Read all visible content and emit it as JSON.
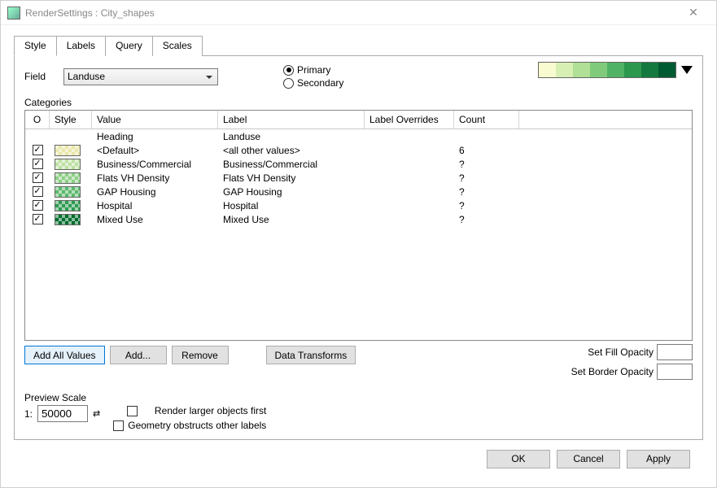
{
  "window": {
    "title": "RenderSettings : City_shapes"
  },
  "tabs": [
    "Style",
    "Labels",
    "Query",
    "Scales"
  ],
  "field": {
    "label": "Field",
    "value": "Landuse"
  },
  "mode": {
    "primary": {
      "label": "Primary",
      "selected": true
    },
    "secondary": {
      "label": "Secondary",
      "selected": false
    }
  },
  "ramp_colors": [
    "#f8fbd0",
    "#d8efb3",
    "#afe095",
    "#7fcb7b",
    "#50b264",
    "#2b984e",
    "#14793f",
    "#005a32"
  ],
  "categories_label": "Categories",
  "grid": {
    "headers": {
      "o": "O",
      "style": "Style",
      "value": "Value",
      "label": "Label",
      "over": "Label Overrides",
      "count": "Count"
    },
    "heading_row": {
      "value": "Heading",
      "label": "Landuse"
    },
    "rows": [
      {
        "checked": true,
        "color": "#e8e7a9",
        "value": "<Default>",
        "label": "<all other values>",
        "count": "6"
      },
      {
        "checked": true,
        "color": "#bde0a1",
        "value": "Business/Commercial",
        "label": "Business/Commercial",
        "count": "?"
      },
      {
        "checked": true,
        "color": "#8dcf86",
        "value": "Flats VH Density",
        "label": "Flats VH Density",
        "count": "?"
      },
      {
        "checked": true,
        "color": "#5cb96c",
        "value": "GAP Housing",
        "label": "GAP Housing",
        "count": "?"
      },
      {
        "checked": true,
        "color": "#2e9c51",
        "value": "Hospital",
        "label": "Hospital",
        "count": "?"
      },
      {
        "checked": true,
        "color": "#006d2c",
        "value": "Mixed Use",
        "label": "Mixed Use",
        "count": "?"
      }
    ]
  },
  "buttons": {
    "add_all": "Add All Values",
    "add": "Add...",
    "remove": "Remove",
    "transforms": "Data Transforms"
  },
  "opacity": {
    "fill_label": "Set Fill Opacity",
    "border_label": "Set Border Opacity"
  },
  "preview": {
    "title": "Preview Scale",
    "prefix": "1:",
    "value": "50000",
    "check_larger": "Render larger objects first",
    "check_obstruct": "Geometry obstructs other labels"
  },
  "footer": {
    "ok": "OK",
    "cancel": "Cancel",
    "apply": "Apply"
  }
}
